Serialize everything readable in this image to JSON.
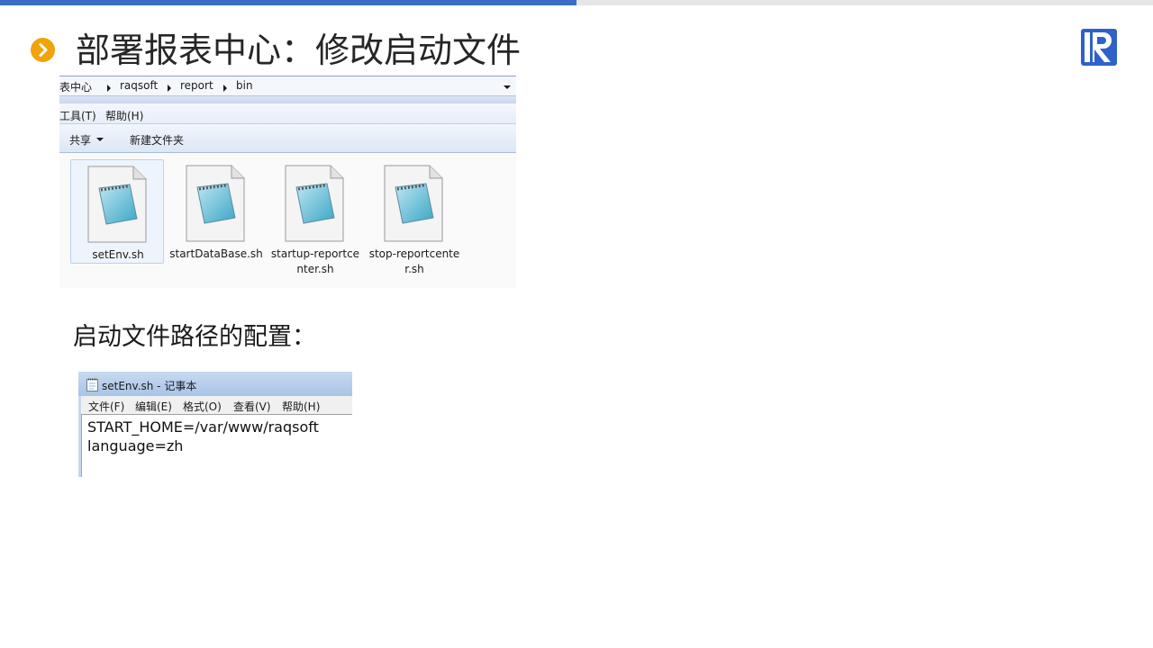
{
  "slide": {
    "title": "部署报表中心：修改启动文件",
    "subtitle": "启动文件路径的配置："
  },
  "explorer": {
    "breadcrumb": [
      "表中心",
      "raqsoft",
      "report",
      "bin"
    ],
    "menu": [
      "工具(T)",
      "帮助(H)"
    ],
    "commands": [
      "共享",
      "新建文件夹"
    ],
    "files": [
      {
        "name": "setEnv.sh",
        "selected": true
      },
      {
        "name": "startDataBase.sh",
        "selected": false
      },
      {
        "name": "startup-reportcenter.sh",
        "selected": false
      },
      {
        "name": "stop-reportcenter.sh",
        "selected": false
      }
    ]
  },
  "notepad": {
    "title": "setEnv.sh - 记事本",
    "menu": [
      "文件(F)",
      "编辑(E)",
      "格式(O)",
      "查看(V)",
      "帮助(H)"
    ],
    "lines": [
      "START_HOME=/var/www/raqsoft",
      "language=zh"
    ]
  },
  "colors": {
    "accent_blue": "#3d6cc8",
    "bullet_orange": "#f0a30a",
    "logo_blue": "#2f62c9"
  },
  "icons": {
    "bullet": "chevron-right-icon",
    "logo": "raqsoft-logo-icon",
    "file": "notepad-file-icon"
  }
}
